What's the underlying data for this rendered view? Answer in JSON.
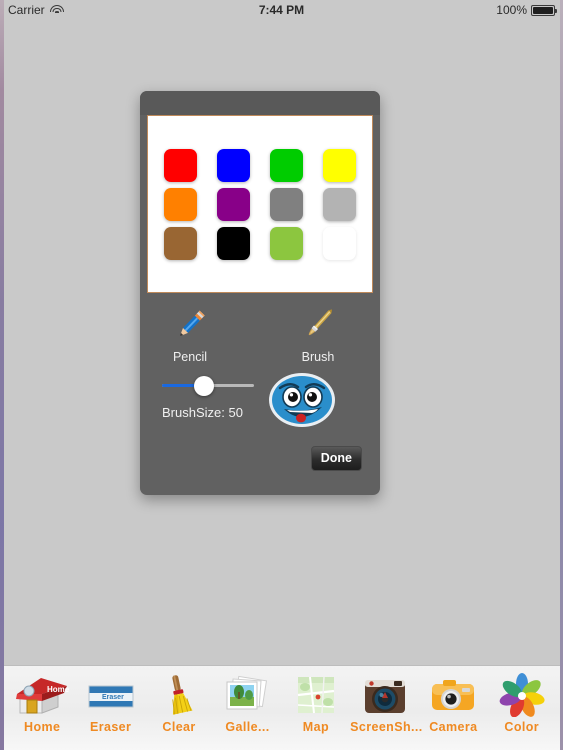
{
  "status_bar": {
    "carrier": "Carrier",
    "wifi_icon": "wifi-icon",
    "time": "7:44 PM",
    "battery_percent": "100%",
    "battery_icon": "battery-icon"
  },
  "canvas": {
    "background_color": "#c9c9c9"
  },
  "color_picker": {
    "title": "",
    "header_color": "#595959",
    "body_color": "#616161",
    "palette_border_color": "#c08a5a",
    "rows": [
      [
        {
          "name": "red",
          "hex": "#ff0000"
        },
        {
          "name": "blue",
          "hex": "#0000ff"
        },
        {
          "name": "green",
          "hex": "#00cc00"
        },
        {
          "name": "yellow",
          "hex": "#ffff00"
        }
      ],
      [
        {
          "name": "orange",
          "hex": "#ff8000"
        },
        {
          "name": "purple",
          "hex": "#880088"
        },
        {
          "name": "gray",
          "hex": "#808080"
        },
        {
          "name": "light-gray",
          "hex": "#b3b3b3"
        }
      ],
      [
        {
          "name": "brown",
          "hex": "#996633"
        },
        {
          "name": "black",
          "hex": "#000000"
        },
        {
          "name": "lime",
          "hex": "#8cc63f"
        },
        {
          "name": "white",
          "hex": "#ffffff"
        }
      ]
    ],
    "tools": [
      {
        "label": "Pencil",
        "icon": "pencil-icon"
      },
      {
        "label": "Brush",
        "icon": "brush-icon"
      }
    ],
    "brush_slider": {
      "label": "BrushSize: 50",
      "value": 50,
      "min": 0,
      "max": 110,
      "fill_color": "#1a69e0",
      "track_color": "#b9b9b9"
    },
    "stamp": {
      "name": "blue-smiley-stamp",
      "face_color": "#2a8ecb",
      "tongue_color": "#cc2222"
    },
    "done_button": "Done"
  },
  "bottom_toolbar": {
    "items": [
      {
        "label": "Home",
        "icon": "home-icon"
      },
      {
        "label": "Eraser",
        "icon": "eraser-icon"
      },
      {
        "label": "Clear",
        "icon": "broom-icon"
      },
      {
        "label": "Galle...",
        "icon": "gallery-icon"
      },
      {
        "label": "Map",
        "icon": "map-icon"
      },
      {
        "label": "ScreenSh...",
        "icon": "screenshot-camera-icon"
      },
      {
        "label": "Camera",
        "icon": "camera-icon"
      },
      {
        "label": "Color",
        "icon": "color-wheel-icon"
      }
    ],
    "label_color": "#ef8a23"
  }
}
